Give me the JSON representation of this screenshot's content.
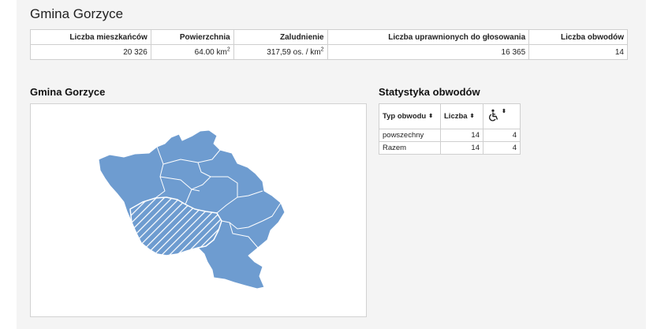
{
  "page": {
    "title": "Gmina Gorzyce"
  },
  "summary": {
    "headers": [
      "Liczba mieszkańców",
      "Powierzchnia",
      "Zaludnienie",
      "Liczba uprawnionych do głosowania",
      "Liczba obwodów"
    ],
    "population": "20 326",
    "area_value": "64.00 km",
    "area_sup": "2",
    "density_value": "317,59 os. / km",
    "density_sup": "2",
    "voters": "16 365",
    "districts": "14"
  },
  "map": {
    "title": "Gmina Gorzyce",
    "fill_color": "#6e9cd0",
    "border_color": "#ffffff",
    "highlight_pattern": "diagonal-hatch"
  },
  "stats": {
    "title": "Statystyka obwodów",
    "headers": {
      "type": "Typ obwodu",
      "count": "Liczba",
      "accessible_icon": "wheelchair-icon"
    },
    "sort_glyph": "⬍",
    "rows": [
      {
        "type": "powszechny",
        "count": "14",
        "accessible": "4"
      },
      {
        "type": "Razem",
        "count": "14",
        "accessible": "4"
      }
    ]
  }
}
